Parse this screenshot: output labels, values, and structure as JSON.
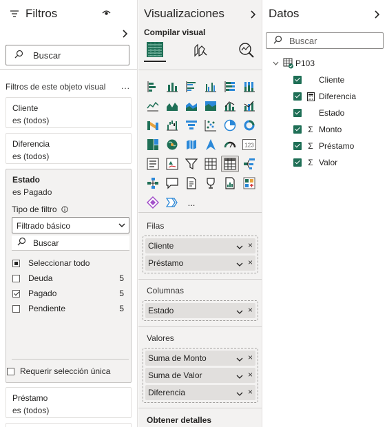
{
  "filters": {
    "title": "Filtros",
    "search_placeholder": "Buscar",
    "section_label": "Filtros de este objeto visual",
    "more": "...",
    "cards": [
      {
        "field": "Cliente",
        "state": "es (todos)"
      },
      {
        "field": "Diferencia",
        "state": "es (todos)"
      }
    ],
    "expanded": {
      "field": "Estado",
      "state": "es Pagado",
      "filter_type_label": "Tipo de filtro",
      "filter_type_value": "Filtrado básico",
      "search_placeholder": "Buscar",
      "options": [
        {
          "label": "Seleccionar todo",
          "count": "",
          "state": "partial"
        },
        {
          "label": "Deuda",
          "count": "5",
          "state": "unchecked"
        },
        {
          "label": "Pagado",
          "count": "5",
          "state": "checked"
        },
        {
          "label": "Pendiente",
          "count": "5",
          "state": "unchecked"
        }
      ],
      "require_single": "Requerir selección única"
    },
    "bottom_card": {
      "field": "Préstamo",
      "state": "es (todos)"
    }
  },
  "viz": {
    "title": "Visualizaciones",
    "build_label": "Compilar visual",
    "tabs": [
      "build-visual-icon",
      "format-visual-icon",
      "analytics-icon"
    ],
    "more_visuals": "...",
    "wells": {
      "rows": {
        "label": "Filas",
        "fields": [
          "Cliente",
          "Préstamo"
        ]
      },
      "columns": {
        "label": "Columnas",
        "fields": [
          "Estado"
        ]
      },
      "values": {
        "label": "Valores",
        "fields": [
          "Suma de Monto",
          "Suma de Valor",
          "Diferencia"
        ]
      },
      "details": {
        "label": "Obtener detalles"
      }
    }
  },
  "datos": {
    "title": "Datos",
    "search_placeholder": "Buscar",
    "table": "P103",
    "fields": [
      {
        "name": "Cliente",
        "icon": ""
      },
      {
        "name": "Diferencia",
        "icon": "calculator-icon"
      },
      {
        "name": "Estado",
        "icon": ""
      },
      {
        "name": "Monto",
        "icon": "sigma-icon"
      },
      {
        "name": "Préstamo",
        "icon": "sigma-icon"
      },
      {
        "name": "Valor",
        "icon": "sigma-icon"
      }
    ]
  },
  "colors": {
    "accent": "#1f6f56",
    "pane_bg": "#f3f2f1",
    "pill_bg": "#e1dfdd"
  }
}
